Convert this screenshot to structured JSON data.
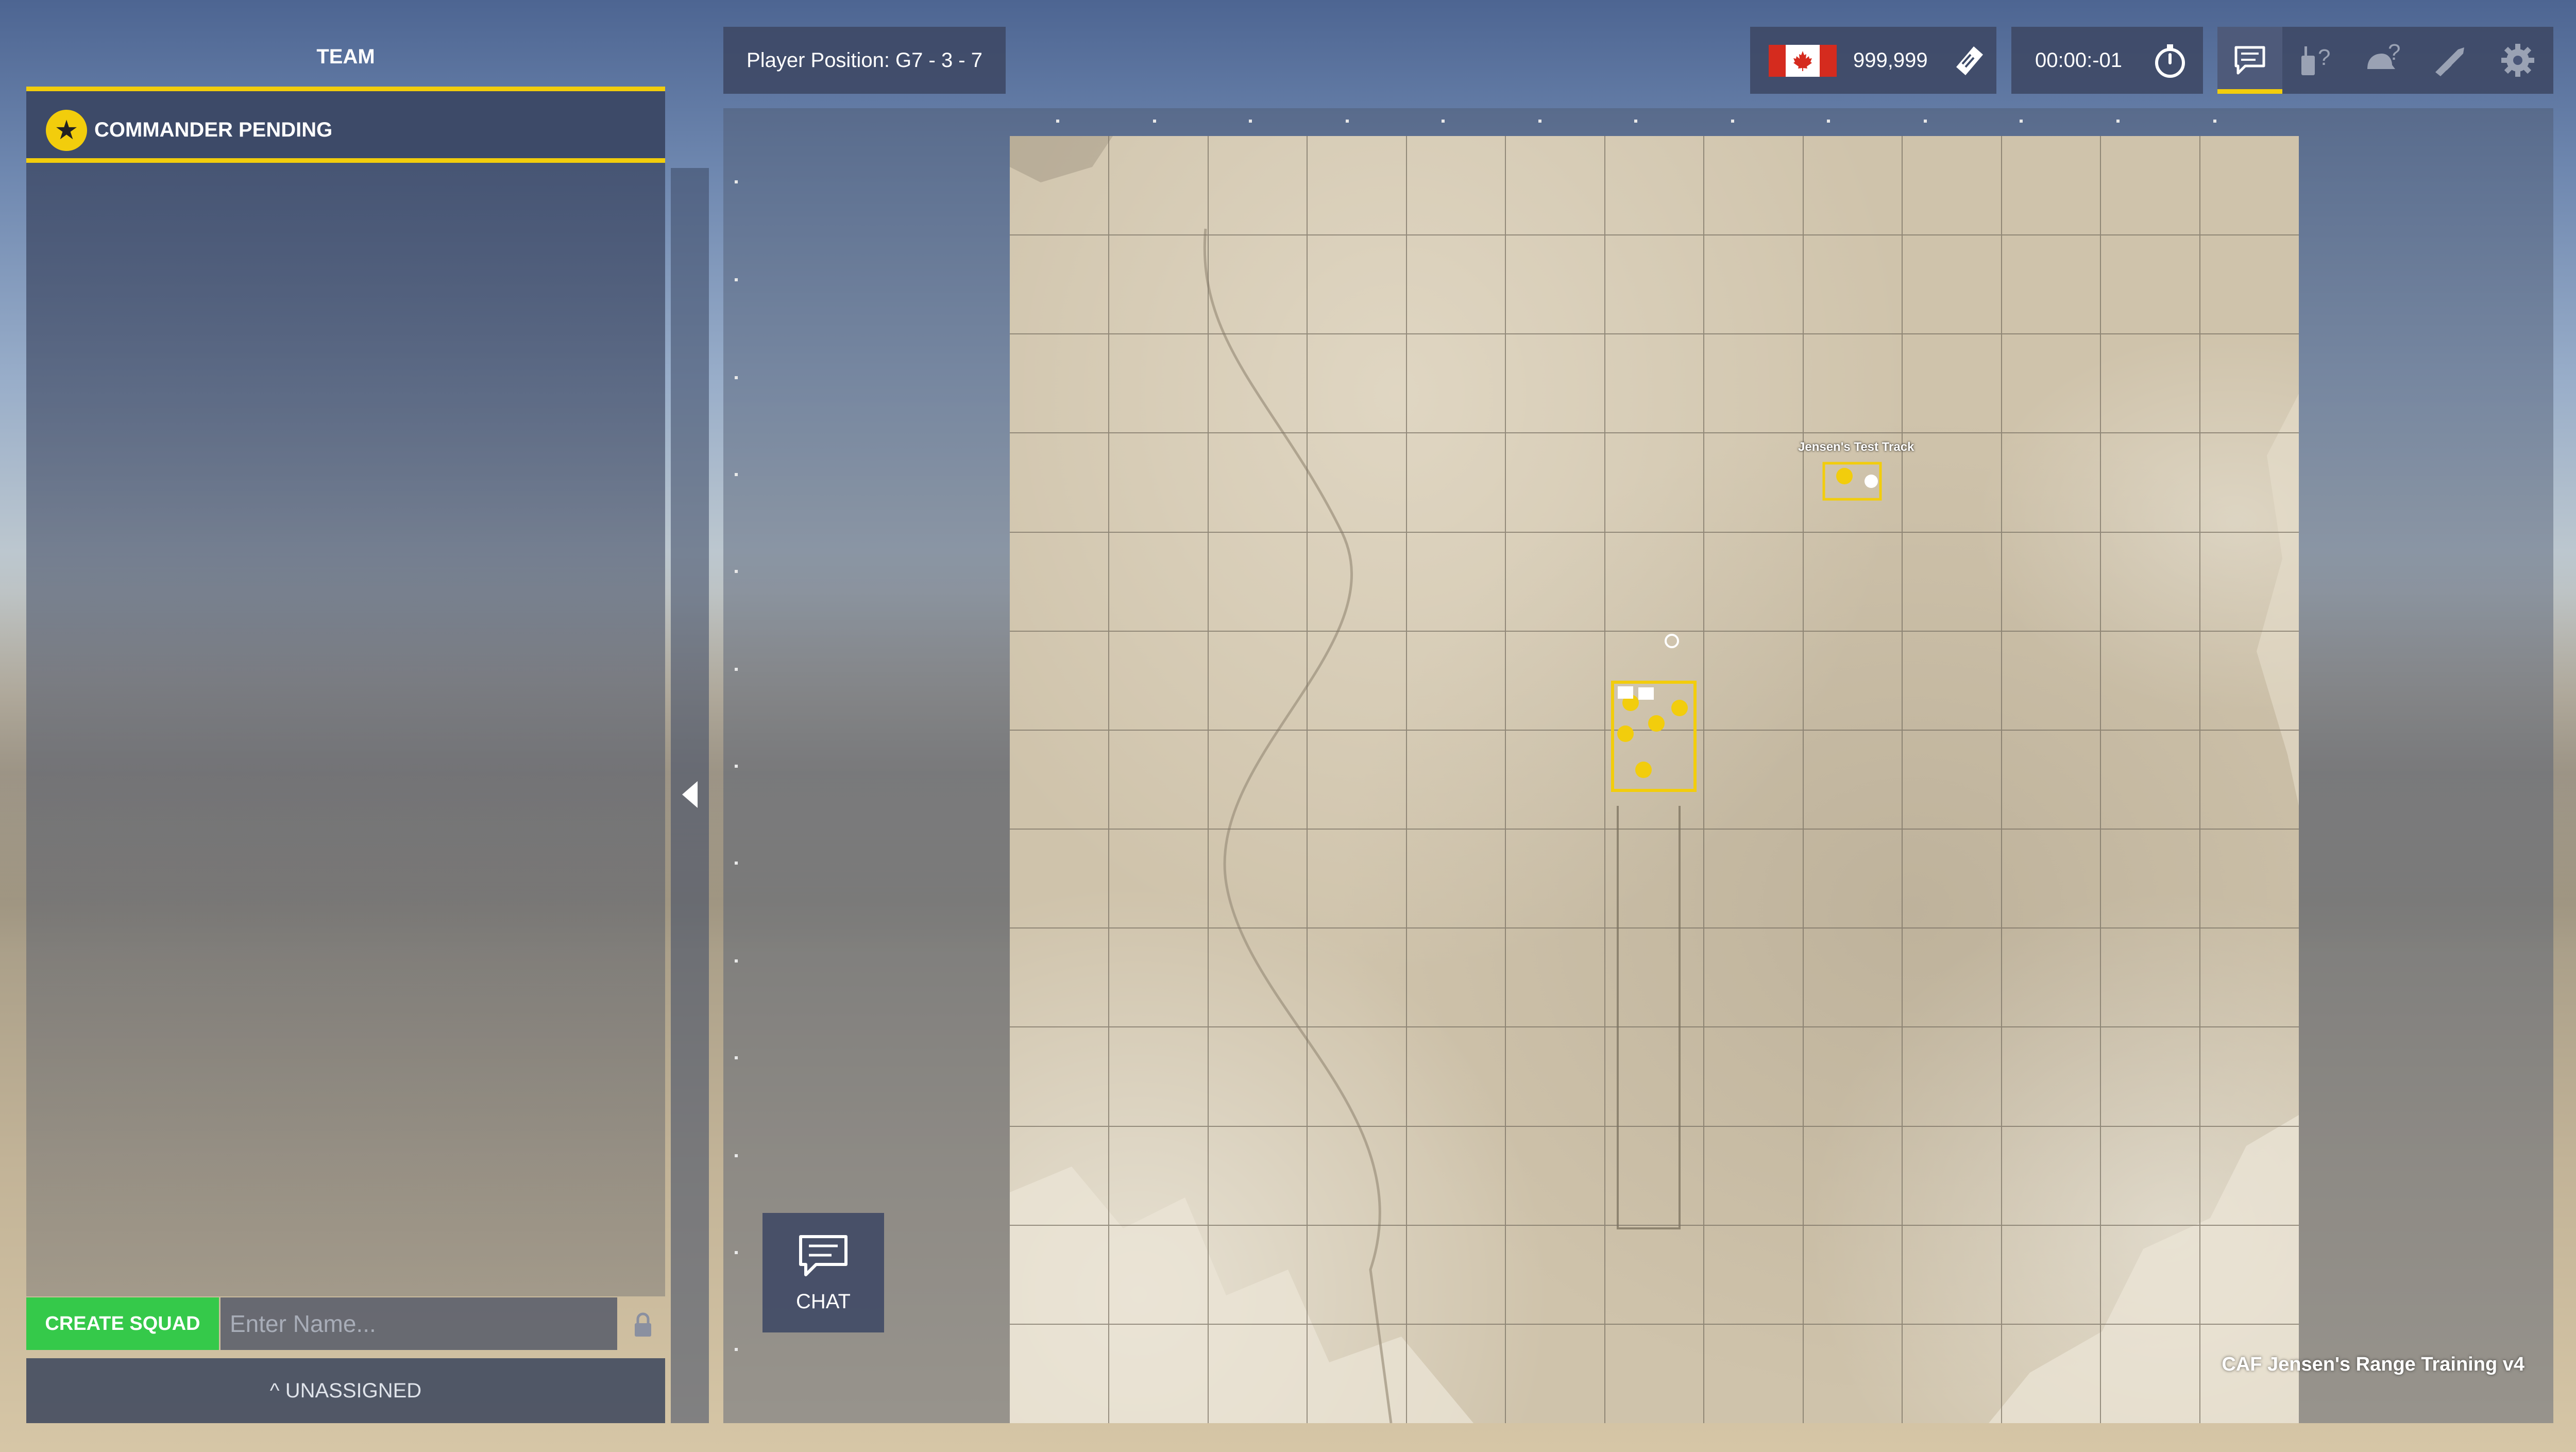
{
  "team_panel": {
    "title": "TEAM",
    "commander_label": "COMMANDER PENDING",
    "create_squad_label": "CREATE SQUAD",
    "squad_name_placeholder": "Enter Name...",
    "unassigned_label": "UNASSIGNED"
  },
  "top_bar": {
    "player_position": "Player Position: G7 - 3 - 7",
    "currency_value": "999,999",
    "flag": "Canada",
    "timer_value": "00:00:-01",
    "menu_buttons": [
      "chat-icon",
      "radio-help-icon",
      "helmet-help-icon",
      "rifle-icon",
      "gear-icon"
    ],
    "active_menu": "chat-icon"
  },
  "map": {
    "title": "CAF Jensen's Range Training v4",
    "poi_label": "Jensen's Test Track",
    "grid": {
      "columns": 13,
      "rows": 13,
      "line_color": "#7a7264"
    }
  },
  "chat_button": {
    "label": "CHAT"
  },
  "colors": {
    "accent_yellow": "#f2cd0c",
    "create_squad_green": "#35c94a",
    "panel_blue": "#3d4a68",
    "flag_red": "#d52b1e"
  }
}
